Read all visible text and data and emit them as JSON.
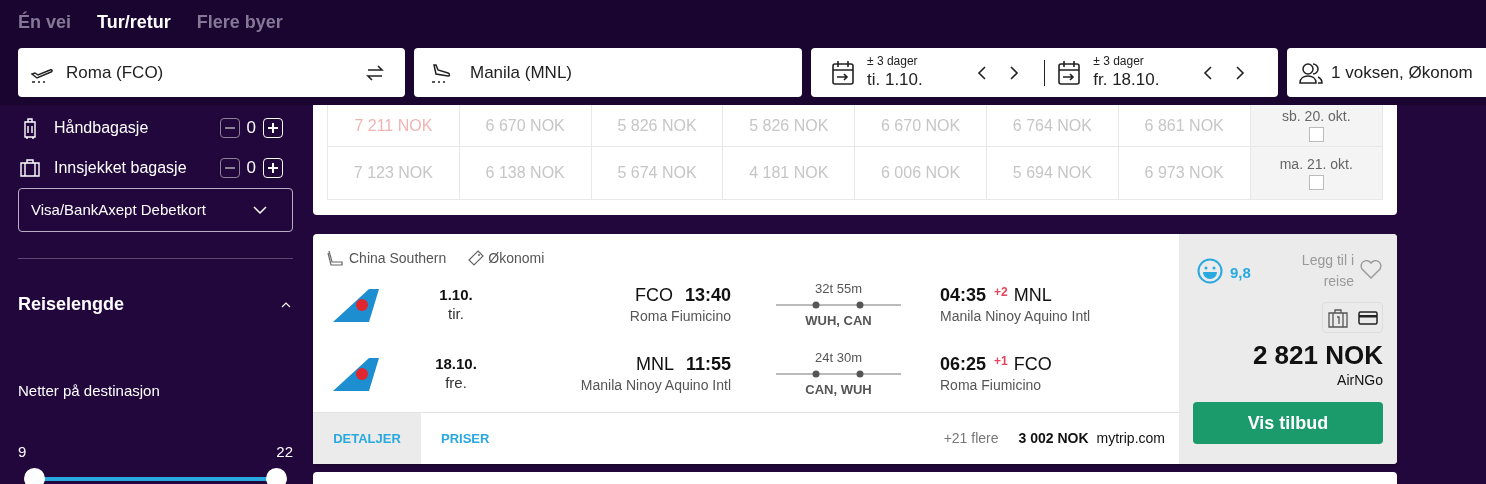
{
  "trip_tabs": [
    {
      "label": "Én vei",
      "selected": false
    },
    {
      "label": "Tur/retur",
      "selected": true
    },
    {
      "label": "Flere byer",
      "selected": false
    }
  ],
  "search": {
    "origin": "Roma (FCO)",
    "destination": "Manila (MNL)",
    "dates": [
      {
        "flex": "± 3 dager",
        "date": "ti. 1.10."
      },
      {
        "flex": "± 3 dager",
        "date": "fr. 18.10."
      }
    ],
    "passengers": "1 voksen, Økonom"
  },
  "baggage": [
    {
      "label": "Håndbagasje",
      "count": "0"
    },
    {
      "label": "Innsjekket bagasje",
      "count": "0"
    }
  ],
  "payment": "Visa/BankAxept Debetkort",
  "trip_length": {
    "title": "Reiselengde",
    "expanded": true,
    "label": "Netter på destinasjon",
    "min": "9",
    "max": "22",
    "thumbs": [
      {
        "level": 0
      },
      {
        "level": 1
      }
    ]
  },
  "price_grid": {
    "rows": [
      {
        "date": "sb. 20. okt.",
        "checked": false,
        "cells": [
          {
            "price": "7 211 NOK",
            "highlighted": true
          },
          {
            "price": "6 670 NOK",
            "highlighted": false
          },
          {
            "price": "5 826 NOK",
            "highlighted": false
          },
          {
            "price": "5 826 NOK",
            "highlighted": false
          },
          {
            "price": "6 670 NOK",
            "highlighted": false
          },
          {
            "price": "6 764 NOK",
            "highlighted": false
          },
          {
            "price": "6 861 NOK",
            "highlighted": false
          }
        ]
      },
      {
        "date": "ma. 21. okt.",
        "checked": false,
        "cells": [
          {
            "price": "7 123 NOK",
            "highlighted": false
          },
          {
            "price": "6 138 NOK",
            "highlighted": false
          },
          {
            "price": "5 674 NOK",
            "highlighted": false
          },
          {
            "price": "4 181 NOK",
            "highlighted": false
          },
          {
            "price": "6 006 NOK",
            "highlighted": false
          },
          {
            "price": "5 694 NOK",
            "highlighted": false
          },
          {
            "price": "6 973 NOK",
            "highlighted": false
          }
        ]
      }
    ]
  },
  "result": {
    "airline": "China Southern",
    "cabin": "Økonomi",
    "legs": [
      {
        "date": "1.10.",
        "weekday": "tir.",
        "dep_code": "FCO",
        "dep_time": "13:40",
        "dep_airport": "Roma Fiumicino",
        "duration": "32t 55m",
        "stops": "WUH, CAN",
        "arr_time": "04:35",
        "day_offset": "+2",
        "arr_code": "MNL",
        "arr_airport": "Manila Ninoy Aquino Intl"
      },
      {
        "date": "18.10.",
        "weekday": "fre.",
        "dep_code": "MNL",
        "dep_time": "11:55",
        "dep_airport": "Manila Ninoy Aquino Intl",
        "duration": "24t 30m",
        "stops": "CAN, WUH",
        "arr_time": "06:25",
        "day_offset": "+1",
        "arr_code": "FCO",
        "arr_airport": "Roma Fiumicino"
      }
    ],
    "tabs": [
      {
        "label": "DETALJER",
        "selected": true
      },
      {
        "label": "PRISER",
        "selected": false
      }
    ],
    "more": "+21 flere",
    "alt_price": "3 002 NOK",
    "alt_provider": "mytrip.com",
    "rating": "9,8",
    "favorite": "Legg til i reise",
    "price": "2 821 NOK",
    "provider": "AirNGo",
    "button": "Vis tilbud"
  }
}
